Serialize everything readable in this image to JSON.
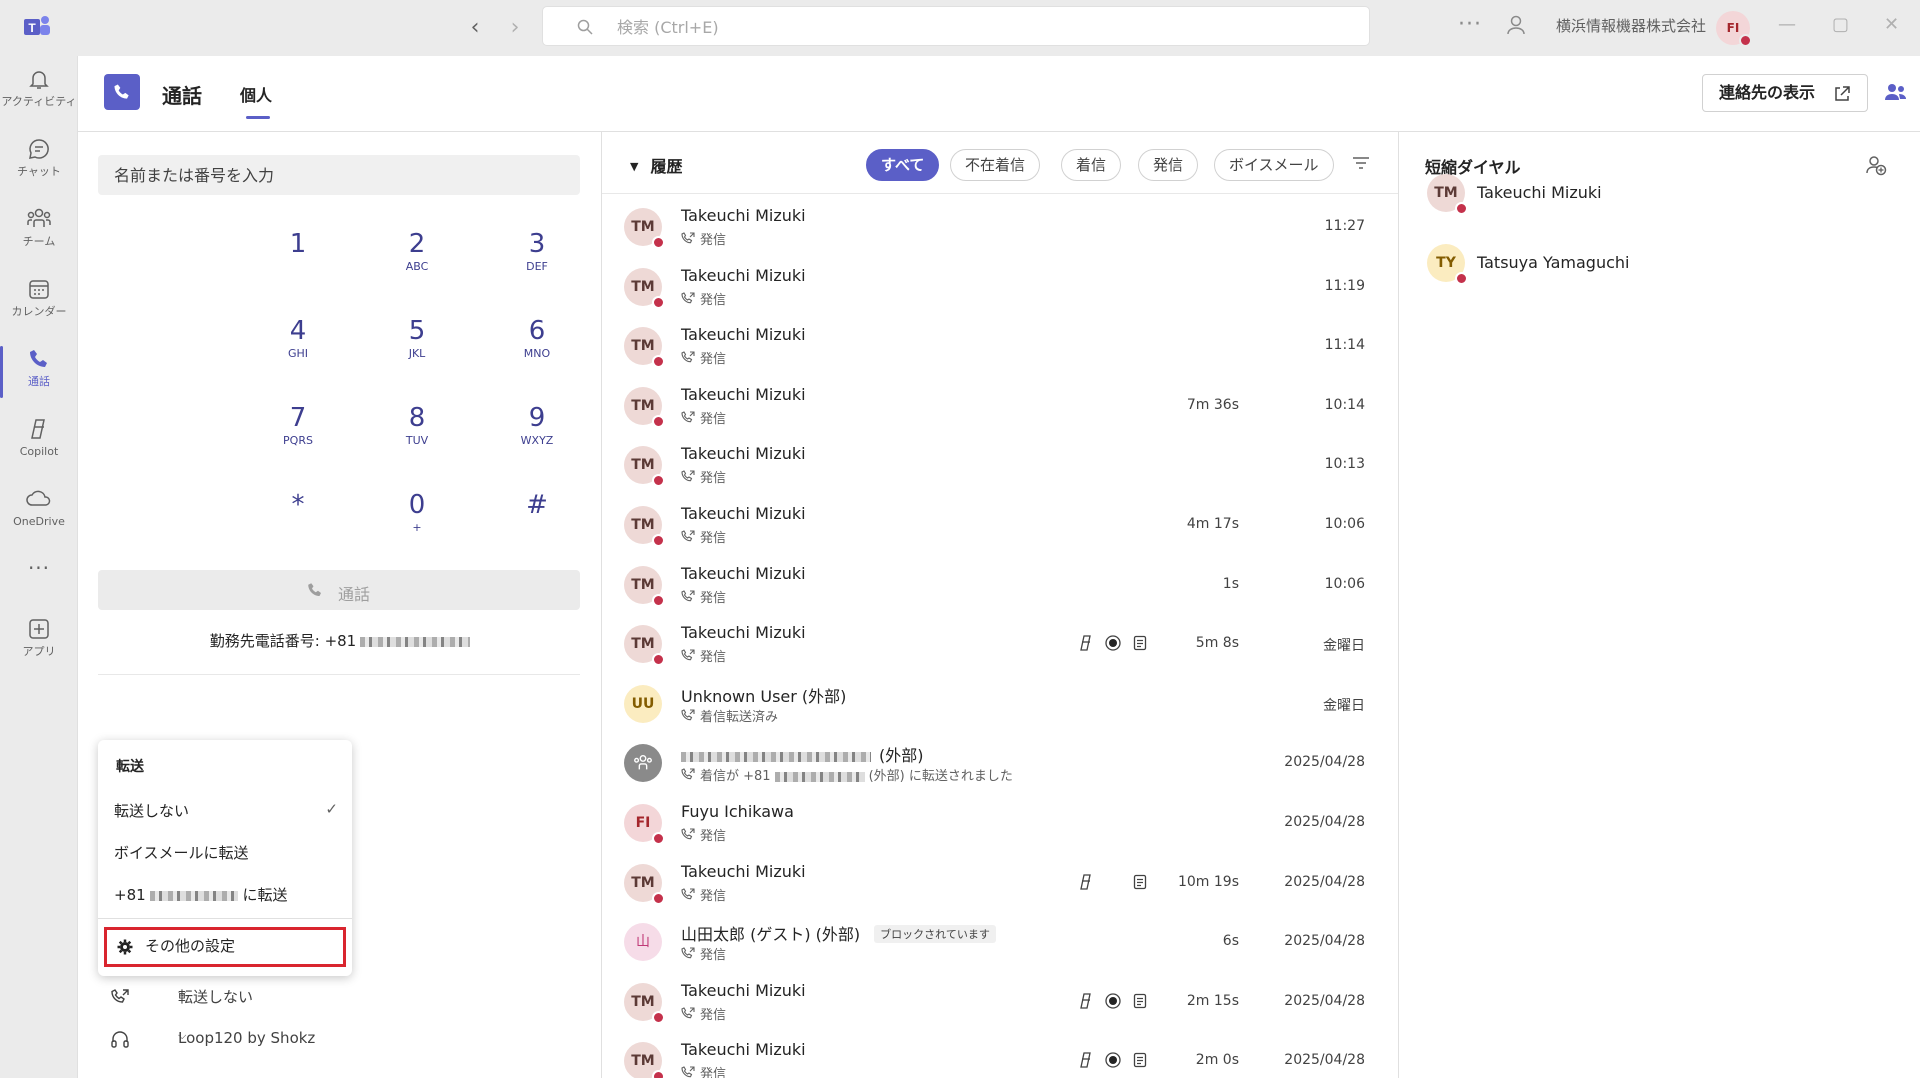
{
  "titlebar": {
    "search_placeholder": "検索 (Ctrl+E)",
    "more": "···",
    "org": "横浜情報機器株式会社",
    "me_initials": "FI"
  },
  "rail": {
    "items": [
      {
        "label": "アクティビティ",
        "icon": "bell-icon"
      },
      {
        "label": "チャット",
        "icon": "chat-icon"
      },
      {
        "label": "チーム",
        "icon": "teams-icon"
      },
      {
        "label": "カレンダー",
        "icon": "calendar-icon"
      },
      {
        "label": "通話",
        "icon": "phone-icon"
      },
      {
        "label": "Copilot",
        "icon": "copilot-icon"
      },
      {
        "label": "OneDrive",
        "icon": "cloud-icon"
      },
      {
        "label": "···",
        "icon": "more-icon"
      },
      {
        "label": "アプリ",
        "icon": "apps-add-icon"
      }
    ]
  },
  "header": {
    "title": "通話",
    "tab": "個人",
    "contacts_button": "連絡先の表示"
  },
  "dialpad": {
    "placeholder": "名前または番号を入力",
    "keys": [
      {
        "d": "1",
        "l": ""
      },
      {
        "d": "2",
        "l": "ABC"
      },
      {
        "d": "3",
        "l": "DEF"
      },
      {
        "d": "4",
        "l": "GHI"
      },
      {
        "d": "5",
        "l": "JKL"
      },
      {
        "d": "6",
        "l": "MNO"
      },
      {
        "d": "7",
        "l": "PQRS"
      },
      {
        "d": "8",
        "l": "TUV"
      },
      {
        "d": "9",
        "l": "WXYZ"
      },
      {
        "d": "*",
        "l": ""
      },
      {
        "d": "0",
        "l": "+"
      },
      {
        "d": "#",
        "l": ""
      }
    ],
    "call_label": "通話",
    "work_number_label": "勤務先電話番号: +81"
  },
  "forward_menu": {
    "heading": "転送",
    "items": [
      "転送しない",
      "ボイスメールに転送",
      "+81",
      "に転送"
    ],
    "more_settings": "その他の設定"
  },
  "status": {
    "forwarding": "転送しない",
    "device": "Loop120 by Shokz"
  },
  "history": {
    "title": "履歴",
    "filters": [
      "すべて",
      "不在着信",
      "着信",
      "発信",
      "ボイスメール"
    ],
    "rows": [
      {
        "initials": "TM",
        "name": "Takeuchi Mizuki",
        "sub": "発信",
        "dur": "",
        "time": "11:27"
      },
      {
        "initials": "TM",
        "name": "Takeuchi Mizuki",
        "sub": "発信",
        "dur": "",
        "time": "11:19"
      },
      {
        "initials": "TM",
        "name": "Takeuchi Mizuki",
        "sub": "発信",
        "dur": "",
        "time": "11:14"
      },
      {
        "initials": "TM",
        "name": "Takeuchi Mizuki",
        "sub": "発信",
        "dur": "7m 36s",
        "time": "10:14"
      },
      {
        "initials": "TM",
        "name": "Takeuchi Mizuki",
        "sub": "発信",
        "dur": "",
        "time": "10:13"
      },
      {
        "initials": "TM",
        "name": "Takeuchi Mizuki",
        "sub": "発信",
        "dur": "4m 17s",
        "time": "10:06"
      },
      {
        "initials": "TM",
        "name": "Takeuchi Mizuki",
        "sub": "発信",
        "dur": "1s",
        "time": "10:06"
      },
      {
        "initials": "TM",
        "name": "Takeuchi Mizuki",
        "sub": "発信",
        "dur": "5m 8s",
        "time": "金曜日"
      },
      {
        "initials": "UU",
        "name": "Unknown User (外部)",
        "sub": "着信転送済み",
        "dur": "",
        "time": "金曜日"
      },
      {
        "initials": "",
        "name": "(外部)",
        "sub": "着信が +81",
        "sub2": "(外部) に転送されました",
        "dur": "",
        "time": "2025/04/28"
      },
      {
        "initials": "FI",
        "name": "Fuyu Ichikawa",
        "sub": "発信",
        "dur": "",
        "time": "2025/04/28"
      },
      {
        "initials": "TM",
        "name": "Takeuchi Mizuki",
        "sub": "発信",
        "dur": "10m 19s",
        "time": "2025/04/28"
      },
      {
        "initials": "山",
        "name": "山田太郎 (ゲスト) (外部)",
        "badge": "ブロックされています",
        "sub": "発信",
        "dur": "6s",
        "time": "2025/04/28"
      },
      {
        "initials": "TM",
        "name": "Takeuchi Mizuki",
        "sub": "発信",
        "dur": "2m 15s",
        "time": "2025/04/28"
      },
      {
        "initials": "TM",
        "name": "Takeuchi Mizuki",
        "sub": "発信",
        "dur": "2m 0s",
        "time": "2025/04/28"
      }
    ]
  },
  "speed_dial": {
    "title": "短縮ダイヤル",
    "contacts": [
      {
        "initials": "TM",
        "name": "Takeuchi Mizuki"
      },
      {
        "initials": "TY",
        "name": "Tatsuya Yamaguchi"
      }
    ]
  },
  "colors": {
    "accent": "#5b5fc7",
    "presence_busy": "#c4314b",
    "highlight_box": "#d9252f"
  }
}
